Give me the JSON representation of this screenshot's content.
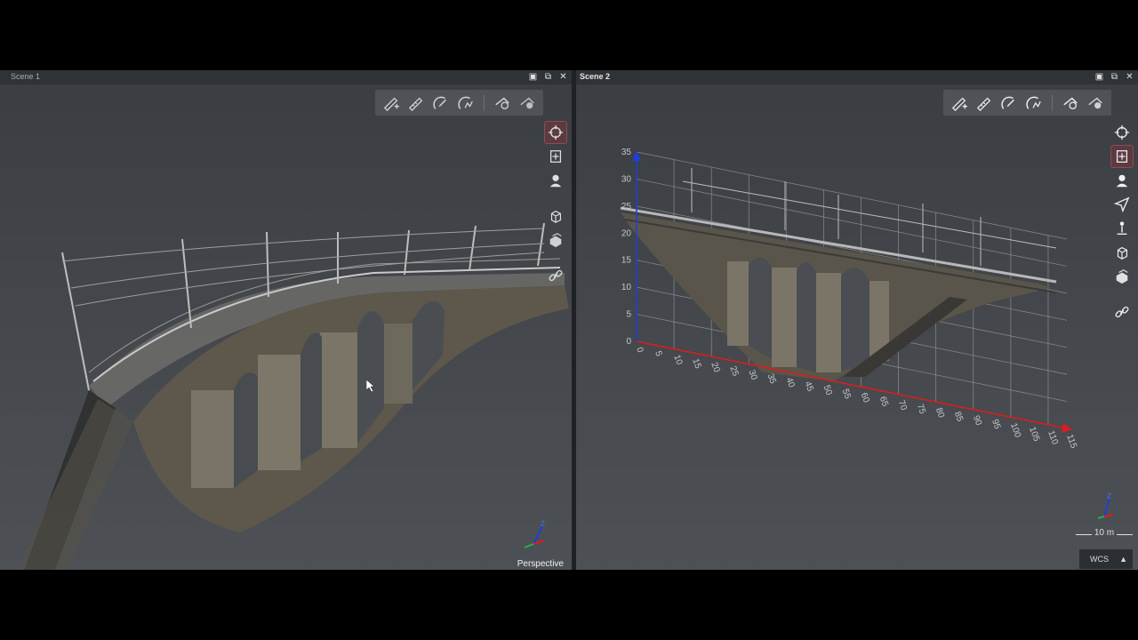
{
  "scene1": {
    "title": "Scene 1",
    "projection": "Perspective",
    "toolbar_icons": [
      "measure-add-icon",
      "measure-distance-icon",
      "measure-angle-icon",
      "measure-polyline-icon",
      "measure-delete-icon",
      "measure-clear-icon"
    ],
    "side_icons": [
      "orbit-icon",
      "pan-icon",
      "walk-icon",
      "top-view-icon",
      "box-view-icon",
      "link-icon"
    ],
    "active_side": "orbit-icon"
  },
  "scene2": {
    "title": "Scene 2",
    "coordinate_system": "WCS",
    "scale_label": "10 m",
    "toolbar_icons": [
      "measure-add-icon",
      "measure-distance-icon",
      "measure-angle-icon",
      "measure-polyline-icon",
      "measure-delete-icon",
      "measure-clear-icon"
    ],
    "side_icons": [
      "orbit-icon",
      "pan-icon",
      "walk-icon",
      "fly-icon",
      "person-icon",
      "top-view-icon",
      "box-view-icon",
      "link-icon"
    ],
    "active_side": "pan-icon",
    "axis_z_ticks": [
      "0",
      "5",
      "10",
      "15",
      "20",
      "25",
      "30",
      "35"
    ],
    "axis_x_ticks": [
      "0",
      "5",
      "10",
      "15",
      "20",
      "25",
      "30",
      "35",
      "40",
      "45",
      "50",
      "55",
      "60",
      "65",
      "70",
      "75",
      "80",
      "85",
      "90",
      "95",
      "100",
      "105",
      "110",
      "115"
    ]
  },
  "window_buttons": [
    "layout-icon",
    "popout-icon",
    "close-icon"
  ],
  "colors": {
    "axis_x": "#d81e1e",
    "axis_y": "#22b14c",
    "axis_z": "#1f3fd8",
    "active_tool": "#8a4b54"
  }
}
